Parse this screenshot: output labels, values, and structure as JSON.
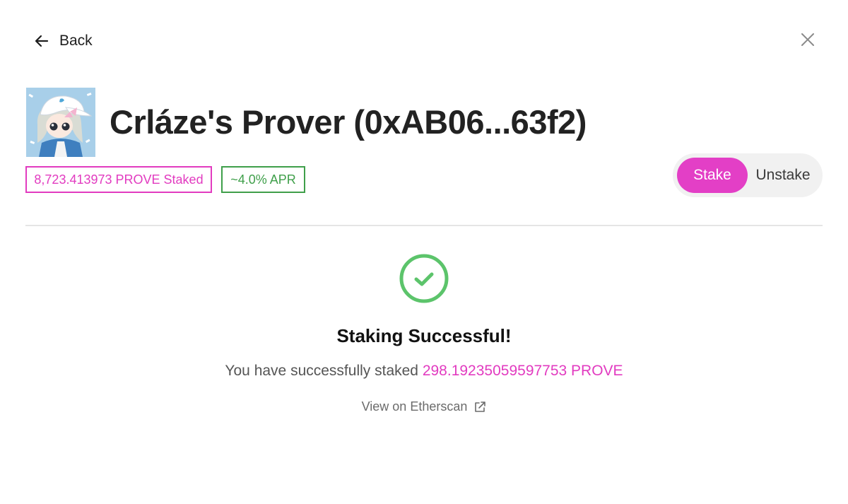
{
  "nav": {
    "back_label": "Back"
  },
  "prover": {
    "name": "Crláze's Prover (0xAB06...63f2)",
    "staked": "8,723.413973 PROVE Staked",
    "apr": "~4.0% APR"
  },
  "tabs": {
    "stake": "Stake",
    "unstake": "Unstake",
    "active": "Stake"
  },
  "result": {
    "title": "Staking Successful!",
    "message_prefix": "You have successfully staked",
    "amount": "298.19235059597753 PROVE",
    "etherscan_label": "View on Etherscan"
  },
  "icons": {
    "back": "arrow-left-icon",
    "close": "close-icon",
    "success": "check-circle-icon",
    "external": "external-link-icon"
  },
  "colors": {
    "accent": "#e33fc6",
    "success": "#5cc46b",
    "apr": "#3f9f4a"
  }
}
